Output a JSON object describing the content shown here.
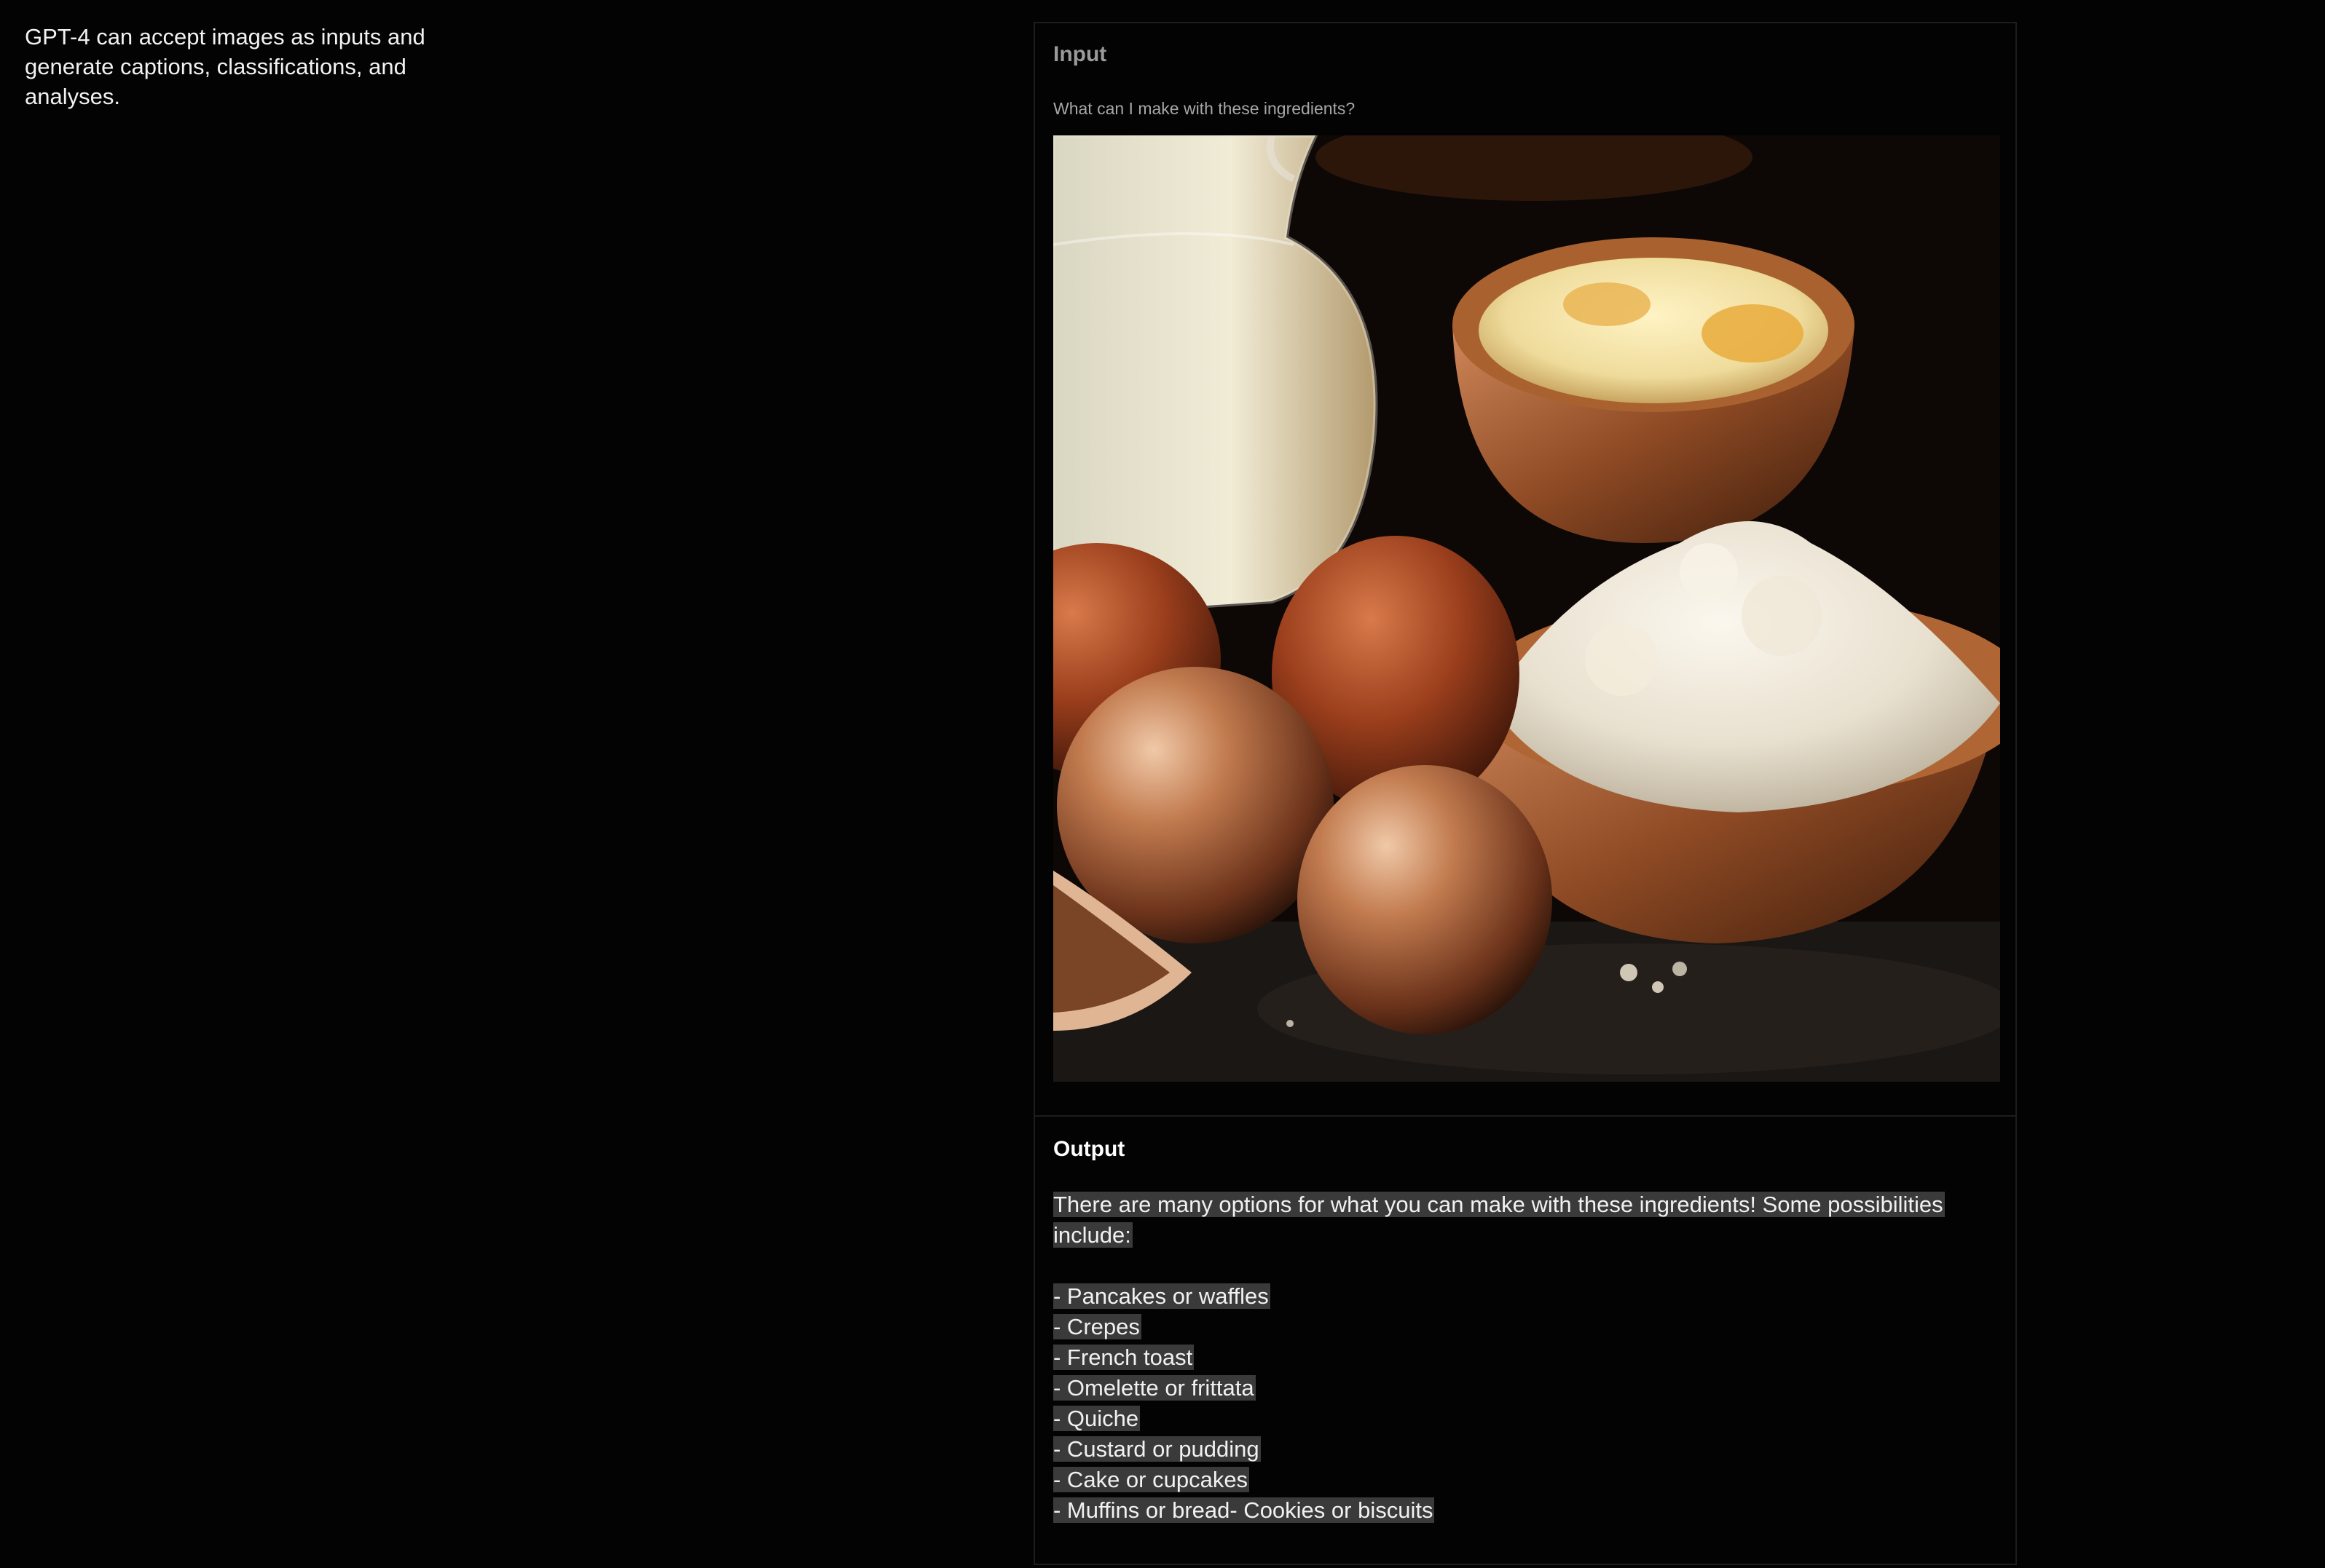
{
  "intro": {
    "text": "GPT-4 can accept images as inputs and generate captions, classifications, and analyses."
  },
  "input": {
    "label": "Input",
    "prompt": "What can I make with these ingredients?",
    "image_subject": "milk-eggs-flour-photo"
  },
  "output": {
    "label": "Output",
    "intro": "There are many options for what you can make with these ingredients! Some possibilities include:",
    "items": [
      "- Pancakes or waffles",
      "- Crepes",
      "- French toast",
      "- Omelette or frittata",
      "- Quiche",
      "- Custard or pudding",
      "- Cake or cupcakes",
      "- Muffins or bread- Cookies or biscuits"
    ]
  },
  "colors": {
    "background": "#030303",
    "border": "#1d1d1d",
    "highlight": "#3a3a3a",
    "muted_text": "#9a9a9a"
  }
}
